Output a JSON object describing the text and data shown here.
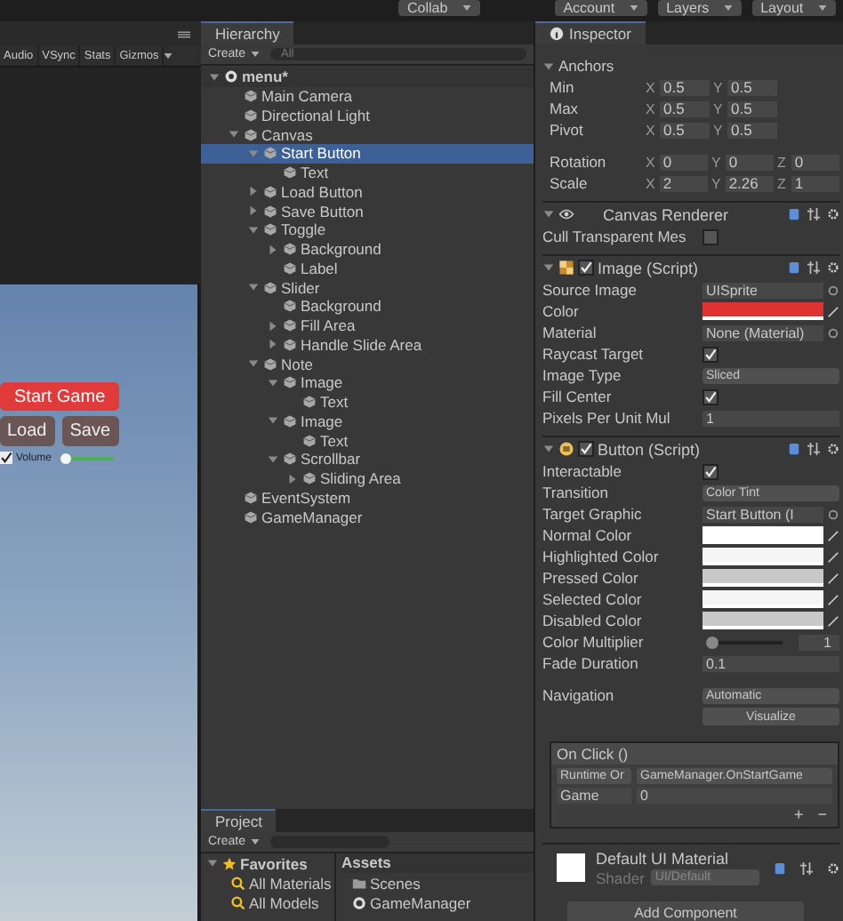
{
  "toolbar": {
    "buttons": [
      {
        "label": "Collab"
      },
      {
        "label": "Account"
      },
      {
        "label": "Layers"
      },
      {
        "label": "Layout"
      }
    ]
  },
  "game_view": {
    "toolbar": [
      "Audio",
      "VSync",
      "Stats",
      "Gizmos"
    ],
    "start_button": "Start Game",
    "buttons": [
      "Load",
      "Save"
    ],
    "toggle": {
      "label": "Volume",
      "checked": true
    },
    "slider": {
      "level": 0.08
    }
  },
  "hierarchy": {
    "title": "Hierarchy",
    "create": "Create",
    "search": {
      "placeholder": "All"
    },
    "scene": {
      "name": "menu*",
      "expanded": true,
      "children": [
        {
          "name": "Main Camera",
          "selected": false
        },
        {
          "name": "Directional Light",
          "selected": false
        },
        {
          "name": "Canvas",
          "selected": false,
          "expanded": true,
          "children": [
            {
              "name": "Start Button",
              "selected": true,
              "expanded": true,
              "children": [
                {
                  "name": "Text",
                  "selected": false
                }
              ]
            },
            {
              "name": "Load Button",
              "selected": false,
              "expanded": false
            },
            {
              "name": "Save Button",
              "selected": false,
              "expanded": false
            },
            {
              "name": "Toggle",
              "selected": false,
              "expanded": true,
              "children": [
                {
                  "name": "Background",
                  "selected": false,
                  "expanded": false
                },
                {
                  "name": "Label",
                  "selected": false
                }
              ]
            },
            {
              "name": "Slider",
              "selected": false,
              "expanded": true,
              "children": [
                {
                  "name": "Background",
                  "selected": false
                },
                {
                  "name": "Fill Area",
                  "selected": false,
                  "expanded": false
                },
                {
                  "name": "Handle Slide Area",
                  "selected": false,
                  "expanded": false
                }
              ]
            },
            {
              "name": "Note",
              "selected": false,
              "expanded": true,
              "children": [
                {
                  "name": "Image",
                  "selected": false,
                  "expanded": true,
                  "children": [
                    {
                      "name": "Text",
                      "selected": false
                    }
                  ]
                },
                {
                  "name": "Image",
                  "selected": false,
                  "expanded": true,
                  "children": [
                    {
                      "name": "Text",
                      "selected": false
                    }
                  ]
                },
                {
                  "name": "Scrollbar",
                  "selected": false,
                  "expanded": true,
                  "children": [
                    {
                      "name": "Sliding Area",
                      "selected": false,
                      "expanded": false
                    }
                  ]
                }
              ]
            }
          ]
        },
        {
          "name": "EventSystem",
          "selected": false
        },
        {
          "name": "GameManager",
          "selected": false
        }
      ]
    }
  },
  "project": {
    "title": "Project",
    "create": "Create",
    "favorites": {
      "label": "Favorites",
      "expanded": true,
      "items": [
        "All Materials",
        "All Models"
      ]
    },
    "assets": {
      "label": "Assets",
      "items": [
        {
          "name": "Scenes",
          "kind": "folder"
        },
        {
          "name": "GameManager",
          "kind": "script"
        }
      ]
    }
  },
  "inspector": {
    "title": "Inspector",
    "rows": [
      {
        "kind": "foldout",
        "label": "Anchors",
        "expanded": true
      },
      {
        "kind": "vector",
        "label": "Min",
        "fields": [
          {
            "axis": "X",
            "value": "0.5"
          },
          {
            "axis": "Y",
            "value": "0.5"
          }
        ]
      },
      {
        "kind": "vector",
        "label": "Max",
        "fields": [
          {
            "axis": "X",
            "value": "0.5"
          },
          {
            "axis": "Y",
            "value": "0.5"
          }
        ]
      },
      {
        "kind": "vector",
        "label": "Pivot",
        "fields": [
          {
            "axis": "X",
            "value": "0.5"
          },
          {
            "axis": "Y",
            "value": "0.5"
          }
        ]
      },
      {
        "kind": "vector",
        "label": "Rotation",
        "fields": [
          {
            "axis": "X",
            "value": "0"
          },
          {
            "axis": "Y",
            "value": "0"
          },
          {
            "axis": "Z",
            "value": "0"
          }
        ]
      },
      {
        "kind": "vector",
        "label": "Scale",
        "fields": [
          {
            "axis": "X",
            "value": "2"
          },
          {
            "axis": "Y",
            "value": "2.26"
          },
          {
            "axis": "Z",
            "value": "1"
          }
        ]
      },
      {
        "kind": "component",
        "label": "Canvas Renderer",
        "expanded": true
      },
      {
        "kind": "checkbox",
        "label": "Cull Transparent Mes",
        "checked": false
      },
      {
        "kind": "component",
        "label": "Image (Script)",
        "expanded": true,
        "enabled": true
      },
      {
        "kind": "object",
        "label": "Source Image",
        "value": "UISprite"
      },
      {
        "kind": "color",
        "label": "Color",
        "color": "#e03232"
      },
      {
        "kind": "object",
        "label": "Material",
        "value": "None (Material)"
      },
      {
        "kind": "checkbox",
        "label": "Raycast Target",
        "checked": true
      },
      {
        "kind": "dropdown",
        "label": "Image Type",
        "value": "Sliced"
      },
      {
        "kind": "checkbox",
        "label": "Fill Center",
        "checked": true
      },
      {
        "kind": "text",
        "label": "Pixels Per Unit Mul",
        "value": "1"
      },
      {
        "kind": "component",
        "label": "Button (Script)",
        "expanded": true,
        "enabled": true
      },
      {
        "kind": "checkbox",
        "label": "Interactable",
        "checked": true
      },
      {
        "kind": "dropdown",
        "label": "Transition",
        "value": "Color Tint"
      },
      {
        "kind": "object",
        "label": "Target Graphic",
        "value": "Start Button (I"
      },
      {
        "kind": "color",
        "label": "Normal Color",
        "color": "#ffffff"
      },
      {
        "kind": "color",
        "label": "Highlighted Color",
        "color": "#f5f5f5"
      },
      {
        "kind": "color",
        "label": "Pressed Color",
        "color": "#c8c8c8"
      },
      {
        "kind": "color",
        "label": "Selected Color",
        "color": "#f5f5f5"
      },
      {
        "kind": "color",
        "label": "Disabled Color",
        "color": "#c8c8c8"
      },
      {
        "kind": "slider",
        "label": "Color Multiplier",
        "level": 0.05,
        "value": "1"
      },
      {
        "kind": "text",
        "label": "Fade Duration",
        "value": "0.1"
      },
      {
        "kind": "dropdown",
        "label": "Navigation",
        "value": "Automatic"
      },
      {
        "kind": "button",
        "label": "Visualize"
      }
    ],
    "on_click": {
      "title": "On Click ()",
      "runtime": "Runtime Or",
      "function": "GameManager.OnStartGame",
      "object": "Game",
      "argument": "0",
      "add": "+",
      "remove": "−"
    },
    "material": {
      "name": "Default UI Material",
      "shader_label": "Shader",
      "shader": "UI/Default"
    },
    "add_component": "Add Component"
  }
}
